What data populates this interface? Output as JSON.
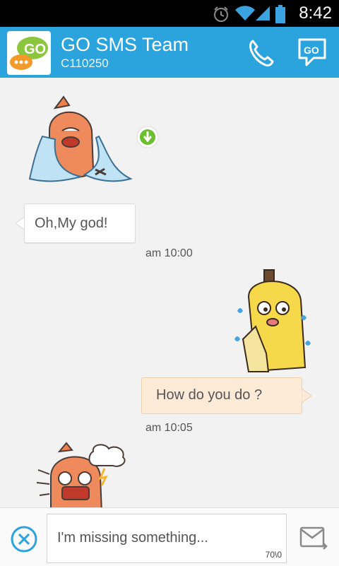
{
  "status_bar": {
    "time": "8:42",
    "icons": [
      "alarm-icon",
      "wifi-icon",
      "signal-icon",
      "battery-icon"
    ]
  },
  "header": {
    "contact_name": "GO SMS Team",
    "contact_number": "C110250",
    "avatar_text": "GO",
    "go_button_text": "GO",
    "accent_color": "#2ba3dd"
  },
  "messages": [
    {
      "direction": "incoming",
      "type": "sticker",
      "sticker": "crying-sausage-sticker",
      "download_icon": "download-icon"
    },
    {
      "direction": "incoming",
      "type": "text",
      "text": "Oh,My god!",
      "time": "am 10:00"
    },
    {
      "direction": "outgoing",
      "type": "sticker",
      "sticker": "nervous-banana-sticker"
    },
    {
      "direction": "outgoing",
      "type": "text",
      "text": "How do you do ?",
      "time": "am 10:05"
    },
    {
      "direction": "incoming",
      "type": "sticker",
      "sticker": "angry-sausage-sticker"
    }
  ],
  "composer": {
    "input_value": "I'm missing something...",
    "char_counter": "70\\0",
    "clear_icon": "clear-icon",
    "send_icon": "send-icon"
  }
}
